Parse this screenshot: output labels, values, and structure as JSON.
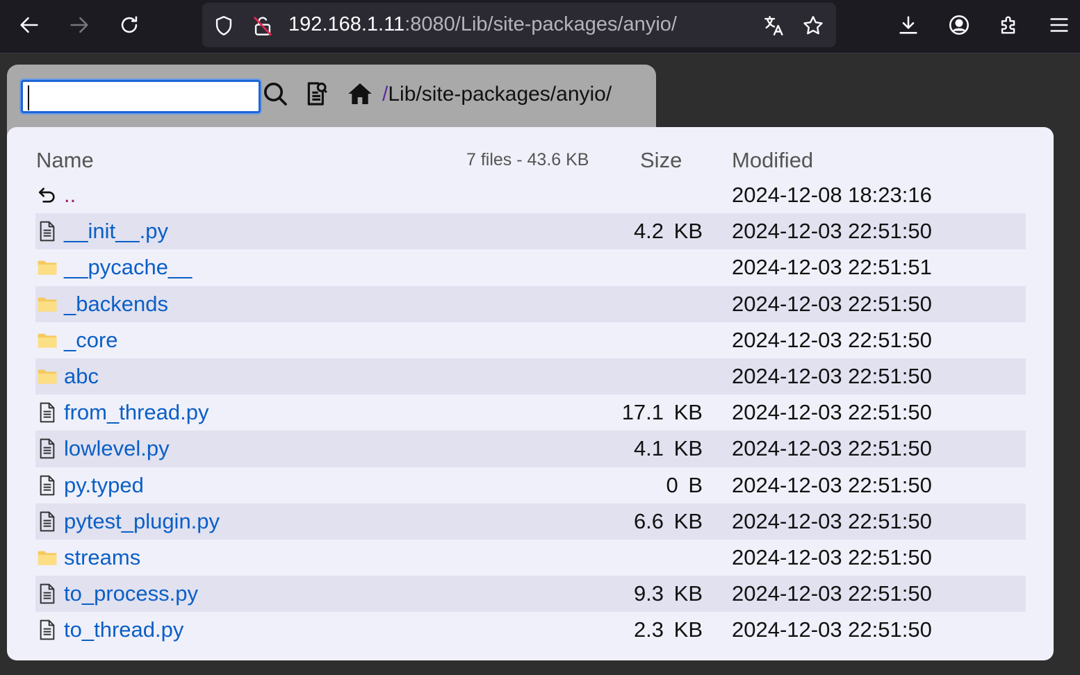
{
  "browser": {
    "url_host": "192.168.1.11",
    "url_rest": ":8080/Lib/site-packages/anyio/",
    "icons": [
      "back-icon",
      "forward-icon",
      "reload-icon",
      "shield-icon",
      "insecure-lock-icon",
      "translate-icon",
      "bookmark-star-icon",
      "download-icon",
      "account-icon",
      "extensions-icon",
      "menu-icon"
    ]
  },
  "header": {
    "search_value": "",
    "breadcrumb_slash": "/",
    "breadcrumb_path": "Lib/site-packages/anyio/"
  },
  "table": {
    "col_name": "Name",
    "summary": "7 files - 43.6 KB",
    "col_size": "Size",
    "col_modified": "Modified"
  },
  "rows": [
    {
      "type": "parent",
      "name": "..",
      "size": "",
      "modified": "2024-12-08 18:23:16"
    },
    {
      "type": "file",
      "name": "__init__.py",
      "size": "4.2 KB",
      "modified": "2024-12-03 22:51:50"
    },
    {
      "type": "folder",
      "name": "__pycache__",
      "size": "",
      "modified": "2024-12-03 22:51:51"
    },
    {
      "type": "folder",
      "name": "_backends",
      "size": "",
      "modified": "2024-12-03 22:51:50"
    },
    {
      "type": "folder",
      "name": "_core",
      "size": "",
      "modified": "2024-12-03 22:51:50"
    },
    {
      "type": "folder",
      "name": "abc",
      "size": "",
      "modified": "2024-12-03 22:51:50"
    },
    {
      "type": "file",
      "name": "from_thread.py",
      "size": "17.1 KB",
      "modified": "2024-12-03 22:51:50"
    },
    {
      "type": "file",
      "name": "lowlevel.py",
      "size": "4.1 KB",
      "modified": "2024-12-03 22:51:50"
    },
    {
      "type": "file",
      "name": "py.typed",
      "size": "0 B",
      "modified": "2024-12-03 22:51:50"
    },
    {
      "type": "file",
      "name": "pytest_plugin.py",
      "size": "6.6 KB",
      "modified": "2024-12-03 22:51:50"
    },
    {
      "type": "folder",
      "name": "streams",
      "size": "",
      "modified": "2024-12-03 22:51:50"
    },
    {
      "type": "file",
      "name": "to_process.py",
      "size": "9.3 KB",
      "modified": "2024-12-03 22:51:50"
    },
    {
      "type": "file",
      "name": "to_thread.py",
      "size": "2.3 KB",
      "modified": "2024-12-03 22:51:50"
    }
  ]
}
